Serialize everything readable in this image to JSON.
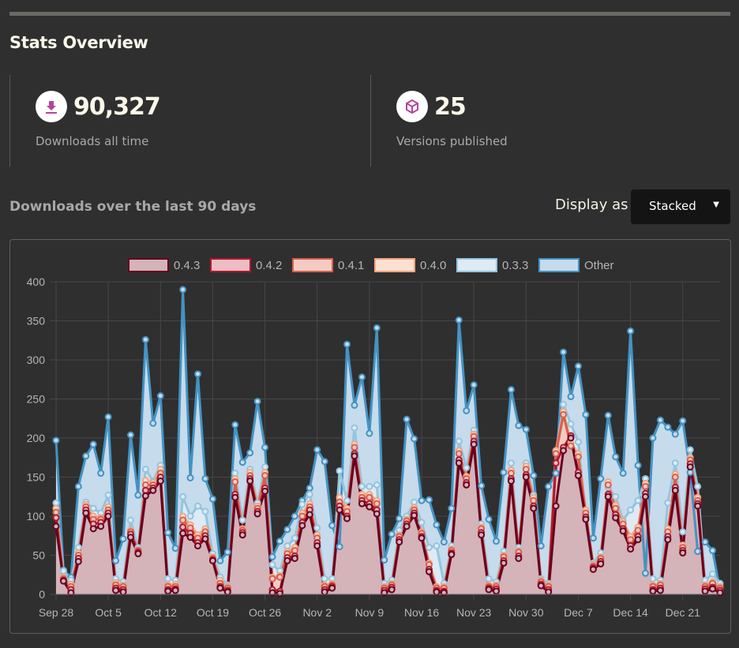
{
  "header": {
    "title": "Stats Overview"
  },
  "stats": [
    {
      "icon": "download-icon",
      "value": "90,327",
      "label": "Downloads all time"
    },
    {
      "icon": "box-icon",
      "value": "25",
      "label": "Versions published"
    }
  ],
  "downloads_section": {
    "title": "Downloads over the last 90 days",
    "display_label": "Display as",
    "display_value": "Stacked"
  },
  "colors": {
    "icon_accent": "#b5459b"
  },
  "chart_data": {
    "type": "area",
    "stacked": true,
    "title": "",
    "xlabel": "",
    "ylabel": "",
    "ylim": [
      0,
      400
    ],
    "yticks": [
      0,
      50,
      100,
      150,
      200,
      250,
      300,
      350,
      400
    ],
    "xtick_labels": [
      "Sep 28",
      "Oct 5",
      "Oct 12",
      "Oct 19",
      "Oct 26",
      "Nov 2",
      "Nov 9",
      "Nov 16",
      "Nov 23",
      "Nov 30",
      "Dec 7",
      "Dec 14",
      "Dec 21"
    ],
    "xtick_every_days": 7,
    "days": 90,
    "grid": true,
    "legend_position": "top-center",
    "series": [
      {
        "name": "0.4.3",
        "line": "#67001f",
        "fill": "#d4b3b9",
        "cumulative": [
          87,
          17,
          2,
          42,
          104,
          84,
          87,
          100,
          5,
          3,
          73,
          52,
          126,
          133,
          145,
          4,
          5,
          78,
          73,
          62,
          71,
          43,
          8,
          3,
          124,
          76,
          145,
          103,
          132,
          2,
          1,
          43,
          46,
          88,
          102,
          62,
          3,
          8,
          108,
          97,
          177,
          116,
          112,
          103,
          2,
          6,
          67,
          87,
          101,
          72,
          29,
          3,
          2,
          51,
          168,
          140,
          192,
          76,
          6,
          4,
          40,
          145,
          46,
          150,
          110,
          11,
          3,
          113,
          184,
          200,
          152,
          96,
          32,
          39,
          125,
          98,
          81,
          58,
          70,
          125,
          4,
          5,
          70,
          133,
          53,
          163,
          113,
          4,
          7,
          2
        ]
      },
      {
        "name": "0.4.2",
        "line": "#b2182b",
        "fill": "#eebcc3",
        "cumulative": [
          98,
          18,
          6,
          46,
          108,
          90,
          92,
          104,
          8,
          6,
          77,
          54,
          133,
          136,
          150,
          6,
          7,
          86,
          78,
          66,
          75,
          44,
          10,
          5,
          128,
          79,
          148,
          106,
          136,
          6,
          4,
          47,
          49,
          92,
          108,
          66,
          6,
          10,
          113,
          100,
          180,
          120,
          116,
          108,
          5,
          9,
          70,
          90,
          104,
          74,
          32,
          5,
          4,
          53,
          172,
          143,
          196,
          79,
          8,
          7,
          43,
          148,
          49,
          153,
          113,
          13,
          6,
          168,
          188,
          203,
          156,
          99,
          34,
          42,
          128,
          102,
          84,
          62,
          74,
          129,
          6,
          8,
          74,
          137,
          56,
          167,
          116,
          7,
          9,
          5
        ]
      },
      {
        "name": "0.4.1",
        "line": "#d6604d",
        "fill": "#f4cbc3",
        "cumulative": [
          105,
          20,
          10,
          50,
          112,
          96,
          96,
          108,
          12,
          10,
          80,
          56,
          140,
          140,
          155,
          10,
          10,
          95,
          85,
          72,
          80,
          46,
          14,
          8,
          144,
          82,
          152,
          110,
          152,
          20,
          22,
          52,
          56,
          100,
          112,
          72,
          10,
          12,
          118,
          106,
          188,
          124,
          124,
          116,
          8,
          12,
          74,
          94,
          108,
          78,
          38,
          8,
          8,
          56,
          180,
          148,
          202,
          84,
          10,
          10,
          48,
          155,
          54,
          160,
          120,
          16,
          10,
          180,
          230,
          190,
          176,
          104,
          36,
          46,
          140,
          110,
          90,
          70,
          82,
          138,
          10,
          12,
          80,
          150,
          60,
          172,
          120,
          10,
          14,
          8
        ]
      },
      {
        "name": "0.4.0",
        "line": "#f4a582",
        "fill": "#fde0d2",
        "cumulative": [
          110,
          22,
          13,
          53,
          115,
          100,
          98,
          112,
          15,
          12,
          82,
          57,
          146,
          143,
          160,
          12,
          13,
          100,
          89,
          76,
          84,
          48,
          18,
          10,
          148,
          84,
          156,
          113,
          156,
          22,
          24,
          55,
          60,
          104,
          116,
          76,
          12,
          14,
          124,
          110,
          192,
          128,
          128,
          120,
          10,
          14,
          76,
          96,
          111,
          80,
          40,
          10,
          10,
          58,
          184,
          151,
          205,
          86,
          12,
          12,
          50,
          159,
          56,
          164,
          124,
          18,
          12,
          184,
          234,
          194,
          180,
          108,
          38,
          48,
          144,
          114,
          93,
          74,
          86,
          142,
          12,
          14,
          84,
          154,
          63,
          175,
          124,
          12,
          16,
          10
        ]
      },
      {
        "name": "0.3.3",
        "line": "#92c5de",
        "fill": "#deeaf4",
        "cumulative": [
          117,
          30,
          18,
          60,
          118,
          110,
          104,
          127,
          20,
          16,
          95,
          60,
          160,
          145,
          165,
          20,
          18,
          125,
          100,
          113,
          106,
          52,
          22,
          12,
          155,
          95,
          160,
          117,
          163,
          38,
          30,
          62,
          72,
          115,
          128,
          85,
          20,
          20,
          158,
          120,
          213,
          138,
          138,
          140,
          14,
          18,
          82,
          100,
          118,
          92,
          60,
          62,
          14,
          62,
          196,
          162,
          210,
          90,
          20,
          16,
          55,
          168,
          60,
          168,
          127,
          20,
          14,
          182,
          243,
          218,
          195,
          102,
          40,
          53,
          137,
          125,
          95,
          108,
          120,
          148,
          20,
          18,
          117,
          168,
          80,
          185,
          138,
          18,
          26,
          14
        ]
      },
      {
        "name": "Other",
        "line": "#4393c3",
        "fill": "#c6dbec",
        "cumulative": [
          197,
          31,
          22,
          138,
          177,
          192,
          155,
          227,
          43,
          71,
          204,
          127,
          326,
          219,
          254,
          79,
          59,
          390,
          149,
          282,
          148,
          122,
          43,
          54,
          217,
          169,
          181,
          247,
          188,
          48,
          68,
          83,
          100,
          120,
          136,
          185,
          170,
          88,
          61,
          320,
          242,
          278,
          206,
          341,
          44,
          77,
          97,
          224,
          199,
          120,
          121,
          89,
          67,
          110,
          351,
          235,
          268,
          139,
          96,
          68,
          156,
          262,
          216,
          211,
          152,
          62,
          138,
          155,
          310,
          253,
          292,
          230,
          72,
          148,
          229,
          176,
          155,
          337,
          165,
          27,
          200,
          223,
          214,
          205,
          222,
          156,
          55,
          67,
          56,
          5
        ]
      }
    ]
  }
}
